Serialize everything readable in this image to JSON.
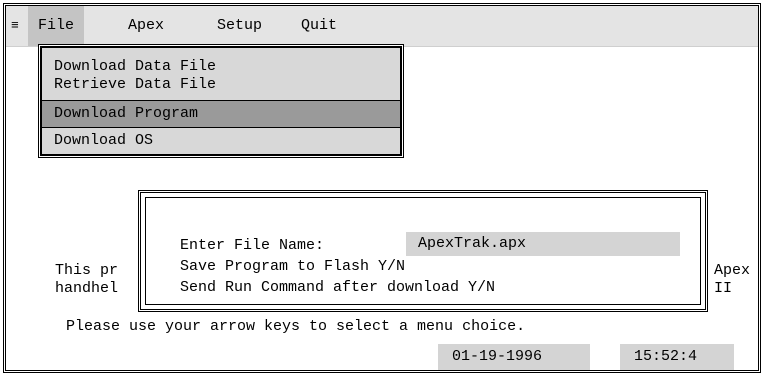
{
  "menubar": {
    "system_icon": "≡",
    "items": [
      {
        "label": "File",
        "active": true
      },
      {
        "label": "Apex",
        "active": false
      },
      {
        "label": "Setup",
        "active": false
      },
      {
        "label": "Quit",
        "active": false
      }
    ]
  },
  "file_menu": {
    "group1": [
      "Download Data File",
      "Retrieve Data File"
    ],
    "download_program": "Download Program",
    "download_os": "Download OS"
  },
  "background": {
    "line1_left": "This pr",
    "line2_left": "handhel",
    "line1_right": "Apex",
    "line2_right": "II"
  },
  "dialog": {
    "prompt": "Enter File Name:",
    "filename": "ApexTrak.apx",
    "save_flash": "Save Program to Flash Y/N",
    "send_run": "Send Run Command after download Y/N"
  },
  "hint": "Please use your arrow keys to select a menu choice.",
  "status": {
    "date": "01-19-1996",
    "time": "15:52:4"
  }
}
